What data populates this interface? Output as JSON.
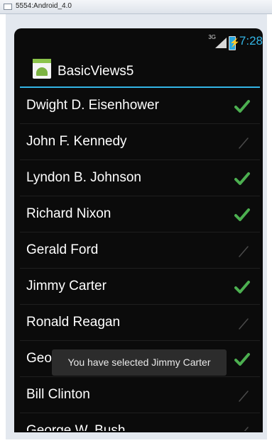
{
  "window": {
    "title": "5554:Android_4.0"
  },
  "status_bar": {
    "network": "3G",
    "time": "7:28"
  },
  "action_bar": {
    "title": "BasicViews5"
  },
  "list": {
    "items": [
      {
        "label": "Dwight D. Eisenhower",
        "checked": true
      },
      {
        "label": "John F. Kennedy",
        "checked": false
      },
      {
        "label": "Lyndon B. Johnson",
        "checked": true
      },
      {
        "label": "Richard Nixon",
        "checked": true
      },
      {
        "label": "Gerald Ford",
        "checked": false
      },
      {
        "label": "Jimmy Carter",
        "checked": true
      },
      {
        "label": "Ronald Reagan",
        "checked": false
      },
      {
        "label": "George H. W. Bush",
        "checked": true
      },
      {
        "label": "Bill Clinton",
        "checked": false
      },
      {
        "label": "George W. Bush",
        "checked": false
      }
    ]
  },
  "toast": {
    "text": "You have selected Jimmy Carter"
  },
  "colors": {
    "accent": "#33b5e5",
    "check_on": "#4caf50",
    "check_off": "#4a4a4a"
  }
}
